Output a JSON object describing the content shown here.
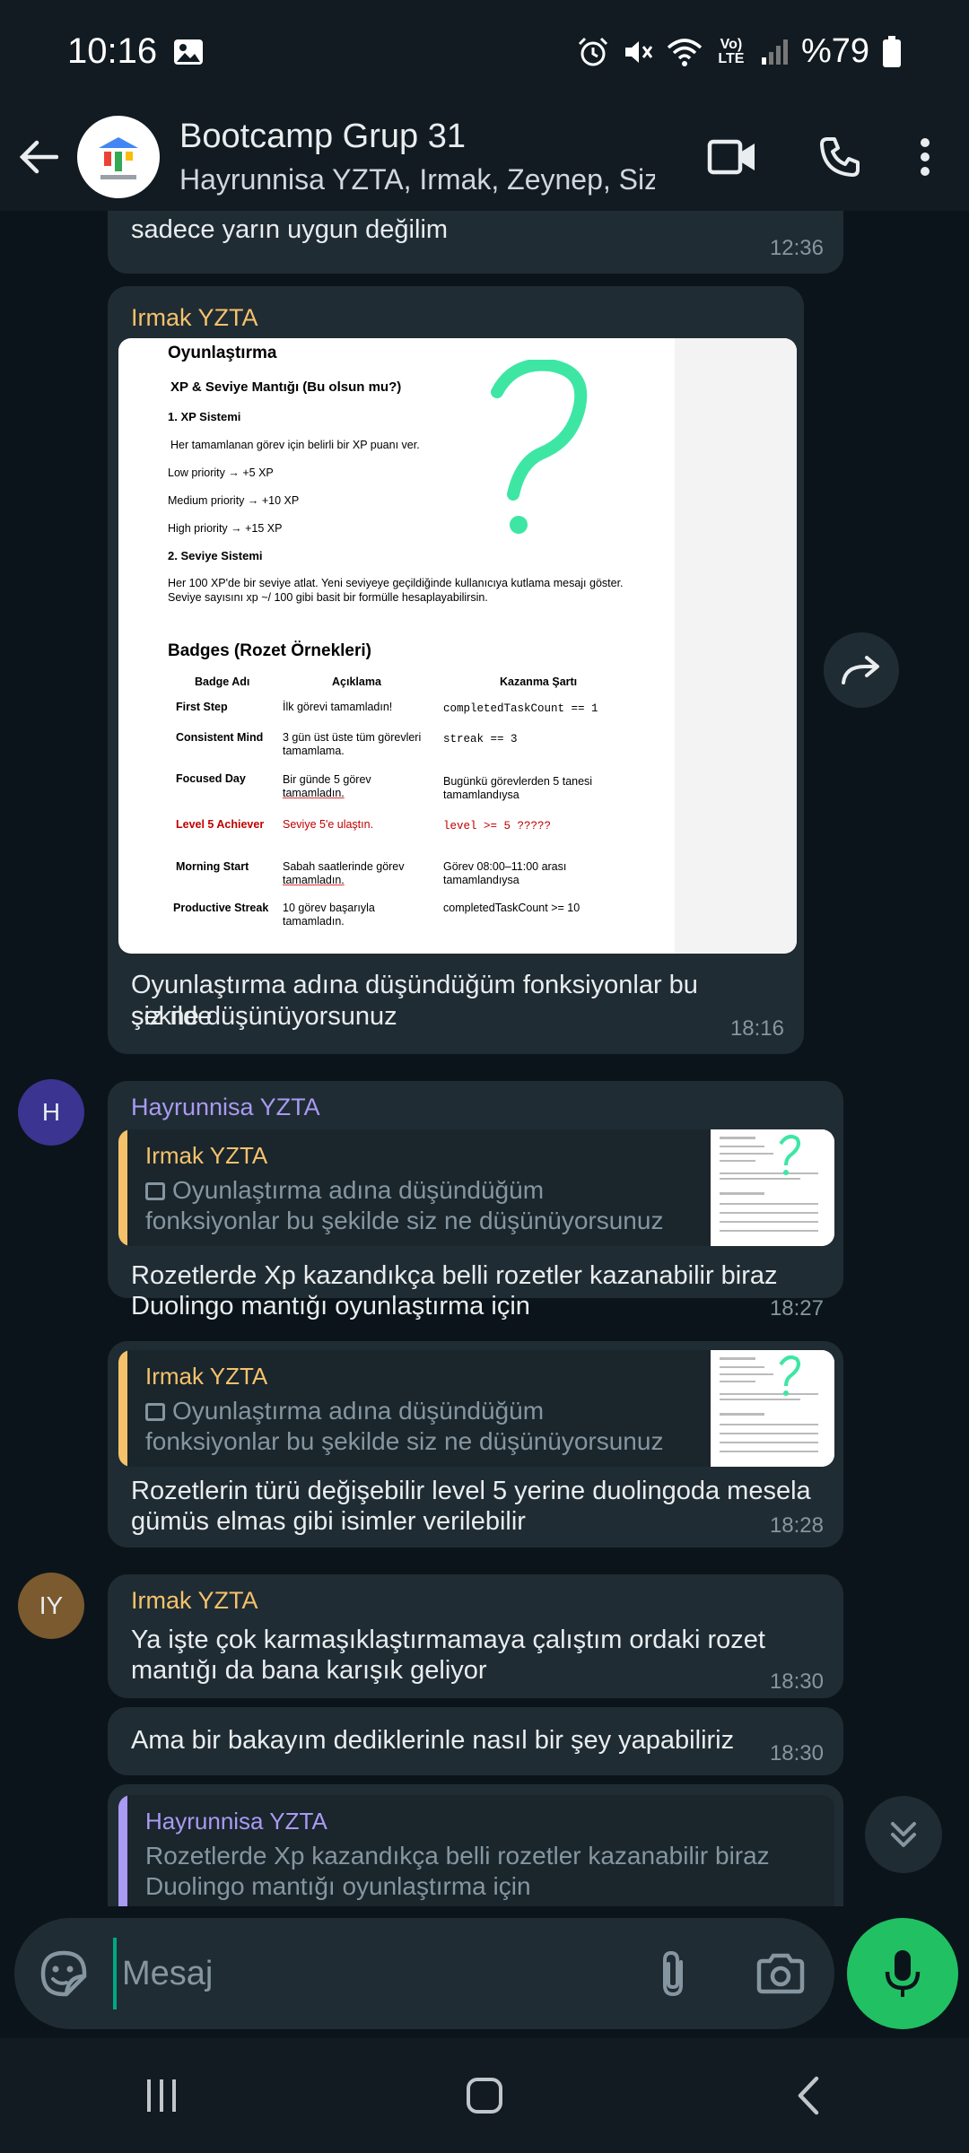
{
  "status": {
    "time": "10:16",
    "battery": "%79",
    "network": "Vo) LTE"
  },
  "header": {
    "title": "Bootcamp Grup 31",
    "subtitle": "Hayrunnisa YZTA, Irmak, Zeynep, Siz"
  },
  "messages": {
    "m0": {
      "text": "sadece yarın uygun değilim",
      "time": "12:36"
    },
    "m1": {
      "sender": "Irmak YZTA",
      "caption_line1": "Oyunlaştırma adına düşündüğüm fonksiyonlar bu şekilde",
      "caption_line2": "siz ne düşünüyorsunuz",
      "time": "18:16"
    },
    "m2": {
      "avatar": "H",
      "sender": "Hayrunnisa YZTA",
      "quote_sender": "Irmak YZTA",
      "quote_line1": "Oyunlaştırma adına düşündüğüm",
      "quote_line2": "fonksiyonlar bu şekilde siz ne düşünüyorsunuz",
      "text_line1": "Rozetlerde Xp kazandıkça belli rozetler kazanabilir biraz",
      "text_line2": "Duolingo mantığı oyunlaştırma için",
      "time": "18:27"
    },
    "m3": {
      "quote_sender": "Irmak YZTA",
      "quote_line1": "Oyunlaştırma adına düşündüğüm",
      "quote_line2": "fonksiyonlar bu şekilde siz ne düşünüyorsunuz",
      "text_line1": "Rozetlerin türü değişebilir level 5 yerine duolingoda mesela",
      "text_line2": "gümüs elmas gibi isimler verilebilir",
      "time": "18:28"
    },
    "m4": {
      "avatar": "IY",
      "sender": "Irmak YZTA",
      "text_line1": "Ya işte çok karmaşıklaştırmamaya çalıştım ordaki rozet",
      "text_line2": "mantığı da bana karışık geliyor",
      "time": "18:30"
    },
    "m5": {
      "text": "Ama bir bakayım dediklerinle nasıl bir şey yapabiliriz",
      "time": "18:30"
    },
    "m6": {
      "quote_sender": "Hayrunnisa YZTA",
      "quote_line1": "Rozetlerde Xp kazandıkça belli rozetler kazanabilir biraz",
      "quote_line2": "Duolingo mantığı oyunlaştırma için"
    }
  },
  "document": {
    "title": "Oyunlaştırma",
    "xp_heading": "XP & Seviye Mantığı (Bu olsun mu?)",
    "xp_system": "1. XP Sistemi",
    "xp_desc": "Her tamamlanan görev için belirli bir XP puanı ver.",
    "low": "Low priority → +5 XP",
    "medium": "Medium priority → +10 XP",
    "high": "High priority → +15 XP",
    "level_system": "2. Seviye Sistemi",
    "level_desc1": "Her 100 XP'de bir seviye atlat. Yeni seviyeye geçildiğinde kullanıcıya kutlama mesajı göster.",
    "level_desc2": "Seviye sayısını xp ~/ 100 gibi basit bir formülle hesaplayabilirsin.",
    "badges_title": "Badges (Rozet Örnekleri)",
    "col_name": "Badge Adı",
    "col_desc": "Açıklama",
    "col_cond": "Kazanma Şartı",
    "rows": [
      {
        "name": "First Step",
        "desc1": "İlk görevi tamamladın!",
        "desc2": "",
        "cond1": "completedTaskCount == 1",
        "cond2": ""
      },
      {
        "name": "Consistent Mind",
        "desc1": "3 gün üst üste tüm görevleri",
        "desc2": "tamamlama.",
        "cond1": "streak == 3",
        "cond2": ""
      },
      {
        "name": "Focused Day",
        "desc1": "Bir günde 5 görev",
        "desc2": "tamamladın.",
        "cond1": "Bugünkü görevlerden 5 tanesi",
        "cond2": "tamamlandıysa"
      },
      {
        "name": "Level 5 Achiever",
        "desc1": "Seviye 5'e ulaştın.",
        "desc2": "",
        "cond1": "level >= 5 ?????",
        "cond2": ""
      },
      {
        "name": "Morning Start",
        "desc1": "Sabah saatlerinde görev",
        "desc2": "tamamladın.",
        "cond1": "Görev 08:00–11:00 arası",
        "cond2": "tamamlandıysa"
      },
      {
        "name": "Productive Streak",
        "desc1": "10 görev başarıyla",
        "desc2": "tamamladın.",
        "cond1": "completedTaskCount >= 10",
        "cond2": ""
      }
    ],
    "question_mark": "?"
  },
  "input": {
    "placeholder": "Mesaj"
  },
  "colors": {
    "accent": "#21c063",
    "irmak": "#f5c26b",
    "hayrunnisa": "#a99af2",
    "bubble": "#202c33",
    "background": "#0b141a"
  },
  "icons": [
    "image-icon",
    "alarm-icon",
    "mute-icon",
    "wifi-icon",
    "signal-icon",
    "battery-icon",
    "back-arrow-icon",
    "video-call-icon",
    "phone-icon",
    "more-vert-icon",
    "forward-icon",
    "chevron-double-down-icon",
    "sticker-icon",
    "attach-icon",
    "camera-icon",
    "mic-icon",
    "recents-icon",
    "home-icon",
    "nav-back-icon"
  ]
}
